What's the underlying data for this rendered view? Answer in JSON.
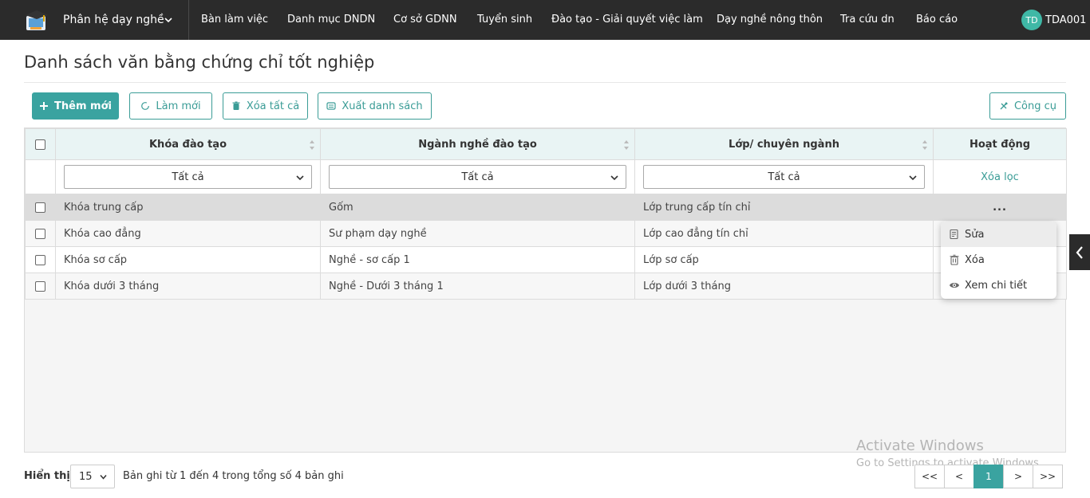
{
  "nav": {
    "module_label": "Phân hệ dạy nghề",
    "items": [
      {
        "label": "Bàn làm việc"
      },
      {
        "label": "Danh mục DNDN"
      },
      {
        "label": "Cơ sở GDNN"
      },
      {
        "label": "Tuyển sinh"
      },
      {
        "label": "Đào tạo - Giải quyết việc làm"
      },
      {
        "label": "Dạy nghề nông thôn"
      },
      {
        "label": "Tra cứu dn"
      },
      {
        "label": "Báo cáo"
      }
    ],
    "user_initials": "TD",
    "user_name": "TDA001"
  },
  "page": {
    "title": "Danh sách văn bằng chứng chỉ tốt nghiệp"
  },
  "toolbar": {
    "add_label": "Thêm mới",
    "refresh_label": "Làm mới",
    "delete_all_label": "Xóa tất cả",
    "export_label": "Xuất danh sách",
    "tools_label": "Công cụ"
  },
  "table": {
    "columns": [
      "Khóa đào tạo",
      "Ngành nghề đào tạo",
      "Lớp/ chuyên ngành",
      "Hoạt động"
    ],
    "filters": [
      "Tất cả",
      "Tất cả",
      "Tất cả"
    ],
    "clear_filter_label": "Xóa lọc",
    "actions_glyph": "...",
    "rows": [
      {
        "course": "Khóa trung cấp",
        "major": "Gốm",
        "class": "Lớp trung cấp tín chỉ"
      },
      {
        "course": "Khóa cao đẳng",
        "major": "Sư phạm dạy nghề",
        "class": "Lớp cao đẳng tín chỉ"
      },
      {
        "course": "Khóa sơ cấp",
        "major": "Nghề - sơ cấp 1",
        "class": "Lớp sơ cấp"
      },
      {
        "course": "Khóa dưới 3 tháng",
        "major": "Nghề - Dưới 3 tháng 1",
        "class": "Lớp dưới 3 tháng"
      }
    ]
  },
  "row_menu": {
    "edit_label": "Sửa",
    "delete_label": "Xóa",
    "view_label": "Xem chi tiết"
  },
  "footer": {
    "show_label": "Hiển thị",
    "page_size": "15",
    "records_text": "Bản ghi từ 1 đến 4 trong tổng số 4 bản ghi",
    "pager": [
      "<<",
      "<",
      "1",
      ">",
      ">>"
    ]
  },
  "watermark": {
    "title": "Activate Windows",
    "subtitle": "Go to Settings to activate Windows."
  },
  "colors": {
    "accent": "#3aa3a0",
    "nav_bg": "#2b2b2b",
    "header_bg": "#e9f4f4"
  }
}
